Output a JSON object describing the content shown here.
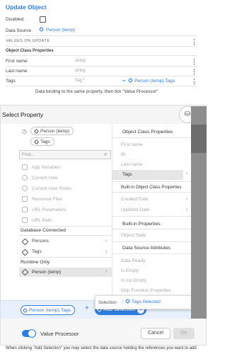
{
  "top": {
    "title": "Update Object",
    "disabled_label": "Disabled",
    "datasource_label": "Data Source",
    "datasource_value": "Person (temp)",
    "values_header": "VALUES ON UPDATE",
    "class_props": "Object Class Properties",
    "rows": [
      {
        "label": "First name",
        "type": "string",
        "value": ""
      },
      {
        "label": "Last name",
        "type": "string",
        "value": ""
      },
      {
        "label": "Tags",
        "type": "Tag *",
        "value": "Person (temp).Tags"
      }
    ],
    "caption1": "Data binding to the same property, then tick \"Value Processor\""
  },
  "dialog": {
    "title": "Select Property",
    "crumbs": [
      "Person (temp)",
      "Tags"
    ],
    "find_placeholder": "Find...",
    "left_items": [
      {
        "label": "App Variables",
        "icon": "app-icon"
      },
      {
        "label": "Current User",
        "icon": "user-icon"
      },
      {
        "label": "Current User Roles",
        "icon": "roles-icon"
      },
      {
        "label": "Resource Files",
        "icon": "file-icon"
      },
      {
        "label": "URL Parameters",
        "icon": "params-icon"
      },
      {
        "label": "URL Path",
        "icon": "path-icon"
      }
    ],
    "db_header": "Database Connected",
    "db_items": [
      "Persons",
      "Tags"
    ],
    "runtime_header": "Runtime Only",
    "runtime_item": "Person (temp)",
    "sections": [
      {
        "header": "Object Class Properties",
        "items": [
          "First name",
          "ID",
          "Last name",
          "Tags"
        ]
      },
      {
        "header": "Built-in Object Class Properties",
        "items": [
          "Created Date",
          "Updated Date"
        ]
      },
      {
        "header": "Built-in Properties",
        "items": [
          "Object State"
        ]
      },
      {
        "header": "Data Source Attributes",
        "items": [
          "Data Ready",
          "Is Empty",
          "Is not Empty",
          "Skip Function Properties"
        ]
      }
    ],
    "chip_value": "Person (temp).Tags",
    "add_selection": "Add Selection",
    "value_processor": "Value Processor",
    "cancel": "Cancel",
    "ok": "OK",
    "selection_label": "Selection",
    "selection_value": "Tags.Selected"
  },
  "caption2": "When clicking \"Add Selection\" you may select the data source holding the references you want to add"
}
